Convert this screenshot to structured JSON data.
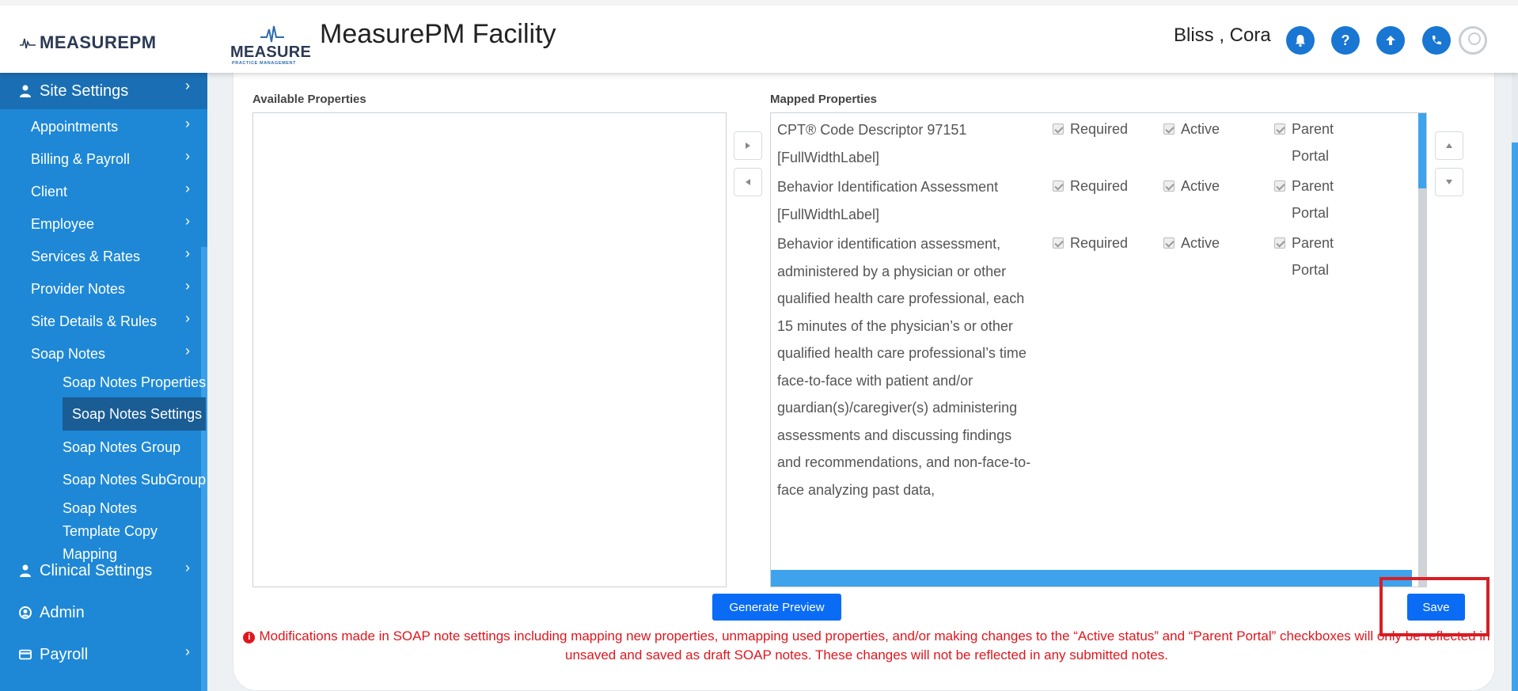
{
  "header": {
    "brand_text": "MEASURE",
    "brand_pm": "PM",
    "logo_word": "MEASURE",
    "logo_sub": "PRACTICE MANAGEMENT",
    "title": "MeasurePM Facility",
    "user": "Bliss , Cora",
    "icons": [
      "bell-icon",
      "help-icon",
      "upload-icon",
      "phone-icon",
      "avatar"
    ]
  },
  "sidebar": {
    "site_settings": "Site Settings",
    "items": [
      {
        "label": "Appointments"
      },
      {
        "label": "Billing & Payroll"
      },
      {
        "label": "Client"
      },
      {
        "label": "Employee"
      },
      {
        "label": "Services & Rates"
      },
      {
        "label": "Provider Notes"
      },
      {
        "label": "Site Details & Rules"
      },
      {
        "label": "Soap Notes"
      }
    ],
    "soap_sub": [
      {
        "label": "Soap Notes Properties"
      },
      {
        "label": "Soap Notes Settings"
      },
      {
        "label": "Soap Notes Group"
      },
      {
        "label": "Soap Notes SubGroup"
      },
      {
        "label": "Soap Notes Template Copy Mapping"
      }
    ],
    "clinical": "Clinical Settings",
    "admin": "Admin",
    "payroll": "Payroll"
  },
  "main": {
    "available_label": "Available Properties",
    "mapped_label": "Mapped Properties",
    "mapped_rows": [
      {
        "desc": "CPT® Code Descriptor 97151 [FullWidthLabel]",
        "required": "Required",
        "active": "Active",
        "parent": "Parent Portal"
      },
      {
        "desc": "Behavior Identification Assessment [FullWidthLabel]",
        "required": "Required",
        "active": "Active",
        "parent": "Parent Portal"
      },
      {
        "desc": "Behavior identification assessment, administered by a physician or other qualified health care professional, each 15 minutes of the physician’s or other qualified health care professional’s time face-to-face with patient and/or guardian(s)/caregiver(s) administering assessments and discussing findings and recommendations, and non-face-to-face analyzing past data,",
        "required": "Required",
        "active": "Active",
        "parent": "Parent Portal"
      }
    ],
    "generate_label": "Generate Preview",
    "save_label": "Save",
    "warning": "Modifications made in SOAP note settings including mapping new properties, unmapping used properties, and/or making changes to the “Active status” and “Parent Portal” checkboxes will only be reflected in unsaved and saved as draft SOAP notes. These changes will not be reflected in any submitted notes."
  },
  "colors": {
    "sidebar": "#1e88d6",
    "primary_button": "#0a6cf5",
    "warning": "#e0161d",
    "highlight": "#d61f26"
  }
}
